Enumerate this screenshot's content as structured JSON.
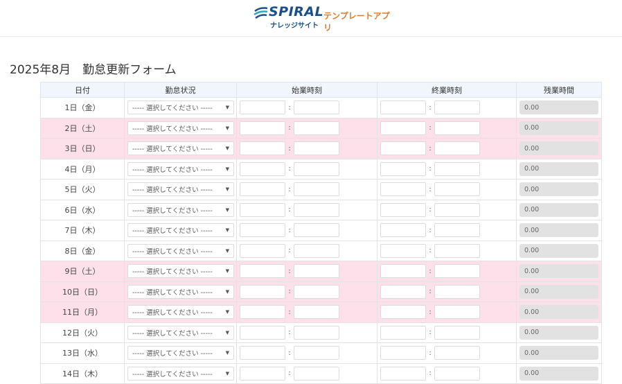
{
  "header": {
    "logo_text": "SPIRAL",
    "logo_sub1": "テンプレートアプリ",
    "logo_sub2": "ナレッジサイト"
  },
  "page_title": "2025年8月　勤怠更新フォーム",
  "table": {
    "columns": [
      "日付",
      "勤怠状況",
      "始業時刻",
      "終業時刻",
      "残業時間"
    ],
    "select_placeholder": "----- 選択してください -----",
    "colon": ":",
    "rows": [
      {
        "date": "1日（金）",
        "holiday": false,
        "overtime": "0.00"
      },
      {
        "date": "2日（土）",
        "holiday": true,
        "overtime": "0.00"
      },
      {
        "date": "3日（日）",
        "holiday": true,
        "overtime": "0.00"
      },
      {
        "date": "4日（月）",
        "holiday": false,
        "overtime": "0.00"
      },
      {
        "date": "5日（火）",
        "holiday": false,
        "overtime": "0.00"
      },
      {
        "date": "6日（水）",
        "holiday": false,
        "overtime": "0.00"
      },
      {
        "date": "7日（木）",
        "holiday": false,
        "overtime": "0.00"
      },
      {
        "date": "8日（金）",
        "holiday": false,
        "overtime": "0.00"
      },
      {
        "date": "9日（土）",
        "holiday": true,
        "overtime": "0.00"
      },
      {
        "date": "10日（日）",
        "holiday": true,
        "overtime": "0.00"
      },
      {
        "date": "11日（月）",
        "holiday": true,
        "overtime": "0.00"
      },
      {
        "date": "12日（火）",
        "holiday": false,
        "overtime": "0.00"
      },
      {
        "date": "13日（水）",
        "holiday": false,
        "overtime": "0.00"
      },
      {
        "date": "14日（木）",
        "holiday": false,
        "overtime": "0.00"
      }
    ]
  },
  "colors": {
    "holiday_row": "#fde0ea",
    "header_bg": "#f0f6fc",
    "logo_blue": "#1a4f8c",
    "logo_orange": "#e07b2a"
  }
}
